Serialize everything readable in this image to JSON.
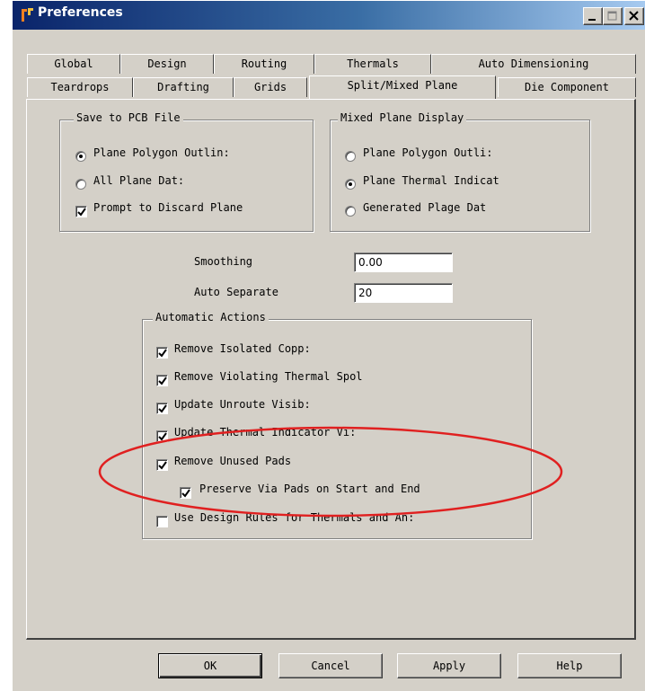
{
  "window": {
    "title": "Preferences"
  },
  "tabs": {
    "row_top": [
      "Global",
      "Design",
      "Routing",
      "Thermals",
      "Auto Dimensioning"
    ],
    "row_bottom": [
      "Teardrops",
      "Drafting",
      "Grids",
      "Split/Mixed Plane",
      "Die Component"
    ],
    "active": "Split/Mixed Plane"
  },
  "save_group": {
    "title": "Save to PCB File",
    "options": [
      {
        "label": "Plane Polygon Outlin:",
        "checked": true
      },
      {
        "label": "All Plane Dat:",
        "checked": false
      }
    ],
    "prompt_label": "Prompt to Discard Plane",
    "prompt_checked": true
  },
  "mixed_group": {
    "title": "Mixed Plane Display",
    "options": [
      {
        "label": "Plane Polygon Outli:",
        "checked": false
      },
      {
        "label": "Plane Thermal Indicat",
        "checked": true
      },
      {
        "label": "Generated Plage Dat",
        "checked": false
      }
    ]
  },
  "smoothing": {
    "label": "Smoothing",
    "value": "0.00"
  },
  "auto_separate": {
    "label": "Auto Separate",
    "value": "20"
  },
  "actions": {
    "title": "Automatic Actions",
    "items": [
      {
        "label": "Remove Isolated Copp:",
        "checked": true
      },
      {
        "label": "Remove Violating Thermal Spol",
        "checked": true
      },
      {
        "label": "Update Unroute Visib:",
        "checked": true
      },
      {
        "label": "Update Thermal Indicator Vi:",
        "checked": true
      },
      {
        "label": "Remove Unused Pads",
        "checked": true
      },
      {
        "label": "Preserve Via Pads on Start and End",
        "checked": true
      },
      {
        "label": "Use Design Rules for Thermals and An:",
        "checked": false
      }
    ]
  },
  "buttons": {
    "ok": "OK",
    "cancel": "Cancel",
    "apply": "Apply",
    "help": "Help"
  },
  "colors": {
    "titlebar": "#0a246a",
    "face": "#d4d0c8",
    "annotation": "#e02020"
  },
  "icons": {
    "app": "pads-logo-icon",
    "minimize": "minimize-icon",
    "maximize": "maximize-icon",
    "close": "close-icon"
  }
}
